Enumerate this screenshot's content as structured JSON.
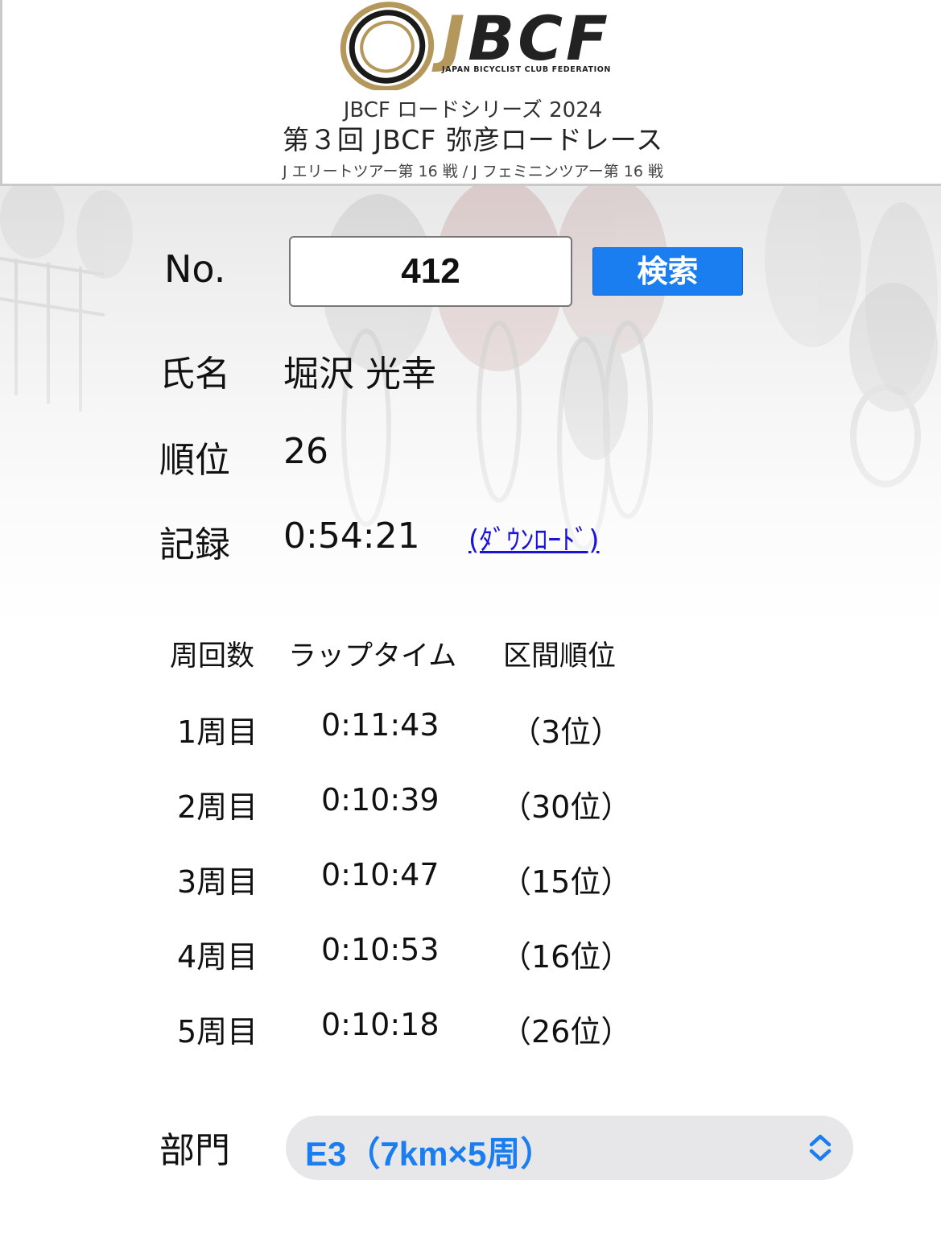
{
  "header": {
    "logo_text": "JBCF",
    "logo_sub": "JAPAN BICYCLIST CLUB FEDERATION",
    "series": "JBCF ロードシリーズ 2024",
    "race": "第３回 JBCF 弥彦ロードレース",
    "tour": "J エリートツアー第 16 戦 / J フェミニンツアー第 16 戦"
  },
  "search": {
    "label": "No.",
    "value": "412",
    "button": "検索"
  },
  "result": {
    "name_label": "氏名",
    "name": "堀沢 光幸",
    "rank_label": "順位",
    "rank": "26",
    "record_label": "記録",
    "record": "0:54:21",
    "download": "(ﾀﾞｳﾝﾛｰﾄﾞ)"
  },
  "laps": {
    "headers": [
      "周回数",
      "ラップタイム",
      "区間順位"
    ],
    "rows": [
      {
        "lap": "1周目",
        "time": "0:11:43",
        "rank": "（3位）"
      },
      {
        "lap": "2周目",
        "time": "0:10:39",
        "rank": "（30位）"
      },
      {
        "lap": "3周目",
        "time": "0:10:47",
        "rank": "（15位）"
      },
      {
        "lap": "4周目",
        "time": "0:10:53",
        "rank": "（16位）"
      },
      {
        "lap": "5周目",
        "time": "0:10:18",
        "rank": "（26位）"
      }
    ]
  },
  "category": {
    "label": "部門",
    "selected": "E3（7km×5周）"
  },
  "colors": {
    "accent": "#1a7df0",
    "logo_gold": "#b4975a",
    "link": "#1a14d8"
  },
  "icons": [
    "jbcf-logo-icon",
    "chevron-updown-icon"
  ]
}
